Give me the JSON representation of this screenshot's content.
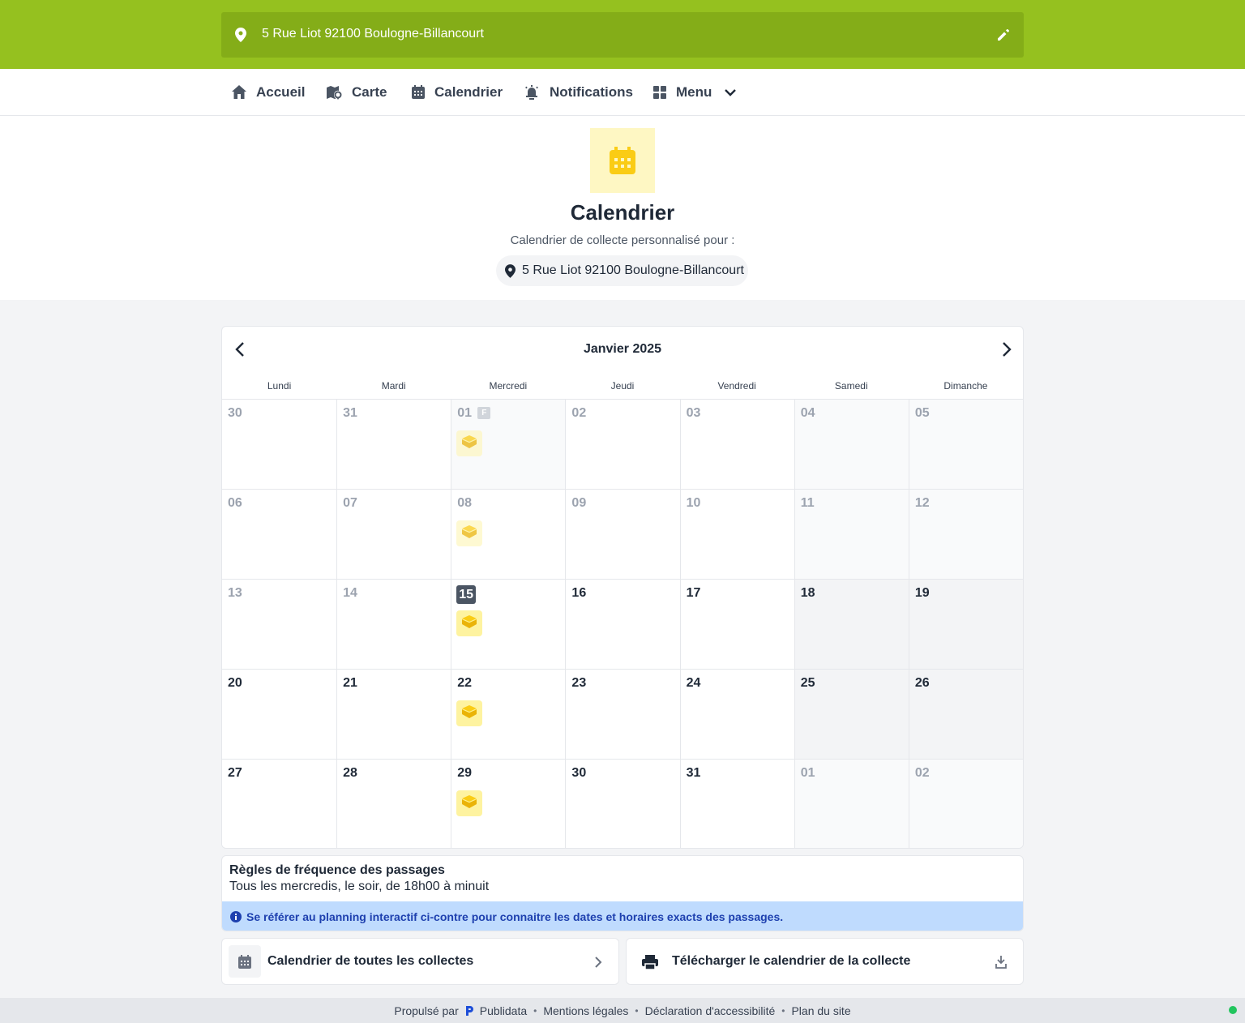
{
  "header": {
    "address": "5 Rue Liot 92100 Boulogne-Billancourt"
  },
  "nav": {
    "items": [
      {
        "label": "Accueil",
        "icon": "home-icon"
      },
      {
        "label": "Carte",
        "icon": "map-icon"
      },
      {
        "label": "Calendrier",
        "icon": "calendar-icon"
      },
      {
        "label": "Notifications",
        "icon": "alarm-bell-icon"
      },
      {
        "label": "Menu",
        "icon": "grid-icon"
      }
    ]
  },
  "hero": {
    "title": "Calendrier",
    "subtitle": "Calendrier de collecte personnalisé pour :",
    "address": "5 Rue Liot 92100 Boulogne-Billancourt"
  },
  "calendar": {
    "month_label": "Janvier 2025",
    "weekdays": [
      "Lundi",
      "Mardi",
      "Mercredi",
      "Jeudi",
      "Vendredi",
      "Samedi",
      "Dimanche"
    ],
    "holiday_badge": "F",
    "today": "15",
    "days": [
      {
        "n": "30",
        "past": true,
        "out": true
      },
      {
        "n": "31",
        "past": true,
        "out": true
      },
      {
        "n": "01",
        "past": true,
        "holiday": true,
        "event": true
      },
      {
        "n": "02",
        "past": true
      },
      {
        "n": "03",
        "past": true
      },
      {
        "n": "04",
        "past": true,
        "weekend": true
      },
      {
        "n": "05",
        "past": true,
        "weekend": true
      },
      {
        "n": "06",
        "past": true
      },
      {
        "n": "07",
        "past": true
      },
      {
        "n": "08",
        "past": true,
        "event": true
      },
      {
        "n": "09",
        "past": true
      },
      {
        "n": "10",
        "past": true
      },
      {
        "n": "11",
        "past": true,
        "weekend": true
      },
      {
        "n": "12",
        "past": true,
        "weekend": true
      },
      {
        "n": "13",
        "past": true
      },
      {
        "n": "14",
        "past": true
      },
      {
        "n": "15",
        "today": true,
        "event": true
      },
      {
        "n": "16"
      },
      {
        "n": "17"
      },
      {
        "n": "18",
        "weekend": true
      },
      {
        "n": "19",
        "weekend": true
      },
      {
        "n": "20"
      },
      {
        "n": "21"
      },
      {
        "n": "22",
        "event": true
      },
      {
        "n": "23"
      },
      {
        "n": "24"
      },
      {
        "n": "25",
        "weekend": true
      },
      {
        "n": "26",
        "weekend": true
      },
      {
        "n": "27"
      },
      {
        "n": "28"
      },
      {
        "n": "29",
        "event": true
      },
      {
        "n": "30"
      },
      {
        "n": "31"
      },
      {
        "n": "01",
        "out": true,
        "weekend": true
      },
      {
        "n": "02",
        "out": true,
        "weekend": true
      }
    ]
  },
  "rules": {
    "title": "Règles de fréquence des passages",
    "text": "Tous les mercredis, le soir, de 18h00 à minuit",
    "info": "Se référer au planning interactif ci-contre pour connaitre les dates et horaires exacts des passages."
  },
  "actions": {
    "all_collections": "Calendrier de toutes les collectes",
    "download": "Télécharger le calendrier de la collecte"
  },
  "footer": {
    "powered_by": "Propulsé par",
    "brand": "Publidata",
    "links": [
      "Mentions légales",
      "Déclaration d'accessibilité",
      "Plan du site"
    ]
  },
  "colors": {
    "brand_green": "#95c11f",
    "event_yellow": "#fde047",
    "info_blue": "#bfdbfe"
  }
}
